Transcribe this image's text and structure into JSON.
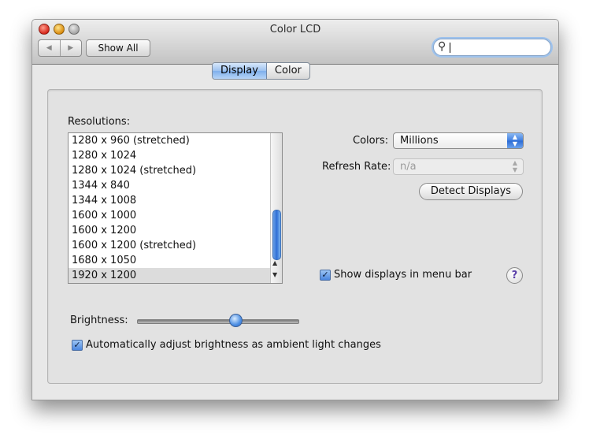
{
  "window": {
    "title": "Color LCD"
  },
  "toolbar": {
    "back_icon": "back-arrow-icon",
    "forward_icon": "forward-arrow-icon",
    "show_all_label": "Show All",
    "search_icon": "search-icon",
    "search_value": ""
  },
  "tabs": [
    {
      "label": "Display",
      "selected": true
    },
    {
      "label": "Color",
      "selected": false
    }
  ],
  "resolutions": {
    "label": "Resolutions:",
    "items": [
      "1280 x 960 (stretched)",
      "1280 x 1024",
      "1280 x 1024 (stretched)",
      "1344 x 840",
      "1344 x 1008",
      "1600 x 1000",
      "1600 x 1200",
      "1600 x 1200 (stretched)",
      "1680 x 1050",
      "1920 x 1200"
    ],
    "selected": "1920 x 1200"
  },
  "colors": {
    "label": "Colors:",
    "value": "Millions"
  },
  "refresh_rate": {
    "label": "Refresh Rate:",
    "value": "n/a",
    "enabled": false
  },
  "detect_displays_label": "Detect Displays",
  "show_displays_menu": {
    "label": "Show displays in menu bar",
    "checked": true
  },
  "help_label": "?",
  "brightness": {
    "label": "Brightness:",
    "level": 0.61
  },
  "auto_brightness": {
    "label": "Automatically adjust brightness as ambient light changes",
    "checked": true
  },
  "accent_color": "#3f7ee0"
}
